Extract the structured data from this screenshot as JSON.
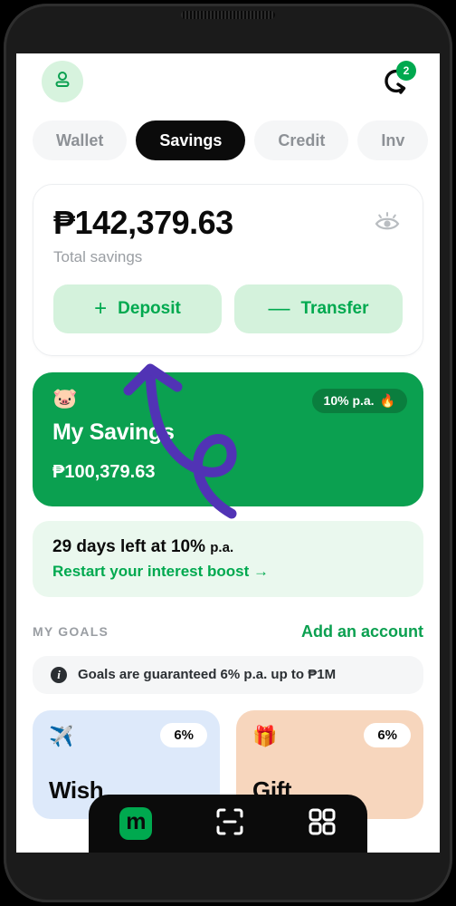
{
  "header": {
    "avatar_icon": "person-icon",
    "history_icon": "history-arrow-icon",
    "notification_count": "2"
  },
  "tabs": [
    {
      "label": "Wallet",
      "active": false
    },
    {
      "label": "Savings",
      "active": true
    },
    {
      "label": "Credit",
      "active": false
    },
    {
      "label": "Inv",
      "active": false
    }
  ],
  "balance": {
    "amount": "₱142,379.63",
    "label": "Total savings",
    "eye_icon": "eye-icon",
    "deposit_sign": "+",
    "deposit_label": "Deposit",
    "transfer_sign": "—",
    "transfer_label": "Transfer"
  },
  "savings_card": {
    "emoji": "🐷",
    "rate": "10% p.a.",
    "rate_emoji": "🔥",
    "name": "My Savings",
    "amount": "₱100,379.63",
    "bg_color": "#0BA050",
    "pill_color": "#0A7E3E"
  },
  "boost": {
    "title_strong": "29 days left at 10%",
    "title_small": "p.a.",
    "link": "Restart your interest boost →"
  },
  "goals": {
    "section_title": "MY GOALS",
    "action": "Add an account",
    "info_icon": "info-icon",
    "info_text": "Goals are guaranteed 6% p.a. up to ₱1M",
    "cards": [
      {
        "emoji": "✈️",
        "pct": "6%",
        "name": "Wish",
        "bg": "#dde9fa"
      },
      {
        "emoji": "🎁",
        "pct": "6%",
        "name": "Gift",
        "bg": "#f7d6bd"
      }
    ]
  },
  "bottom_nav": [
    {
      "icon": "maya-logo-icon",
      "label": "m"
    },
    {
      "icon": "qr-scan-icon",
      "label": ""
    },
    {
      "icon": "apps-grid-icon",
      "label": ""
    }
  ],
  "annotation": {
    "color": "#5133B5",
    "shape": "hand-drawn-looping-arrow-pointing-to-deposit"
  }
}
